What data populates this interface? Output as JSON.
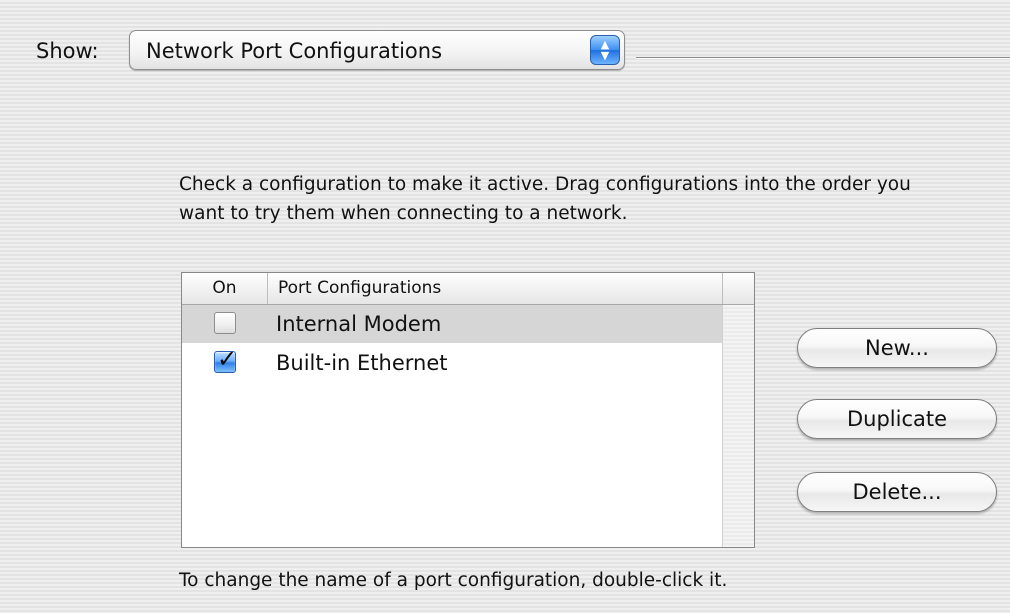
{
  "show": {
    "label": "Show:",
    "selected": "Network Port Configurations"
  },
  "instructions": "Check a configuration to make it active. Drag configurations into the order you want to try them when connecting to a network.",
  "table": {
    "columns": [
      "On",
      "Port Configurations"
    ],
    "rows": [
      {
        "name": "Internal Modem",
        "checked": false,
        "selected": true
      },
      {
        "name": "Built-in Ethernet",
        "checked": true,
        "selected": false
      }
    ]
  },
  "buttons": {
    "new": "New...",
    "duplicate": "Duplicate",
    "delete": "Delete..."
  },
  "footer_note": "To change the name of a port configuration, double-click it.",
  "icons": {
    "popup": "up-down-arrows-icon",
    "check": "checkmark-icon"
  },
  "colors": {
    "accent": "#3b8ff2",
    "selected_row": "#d6d6d6"
  }
}
